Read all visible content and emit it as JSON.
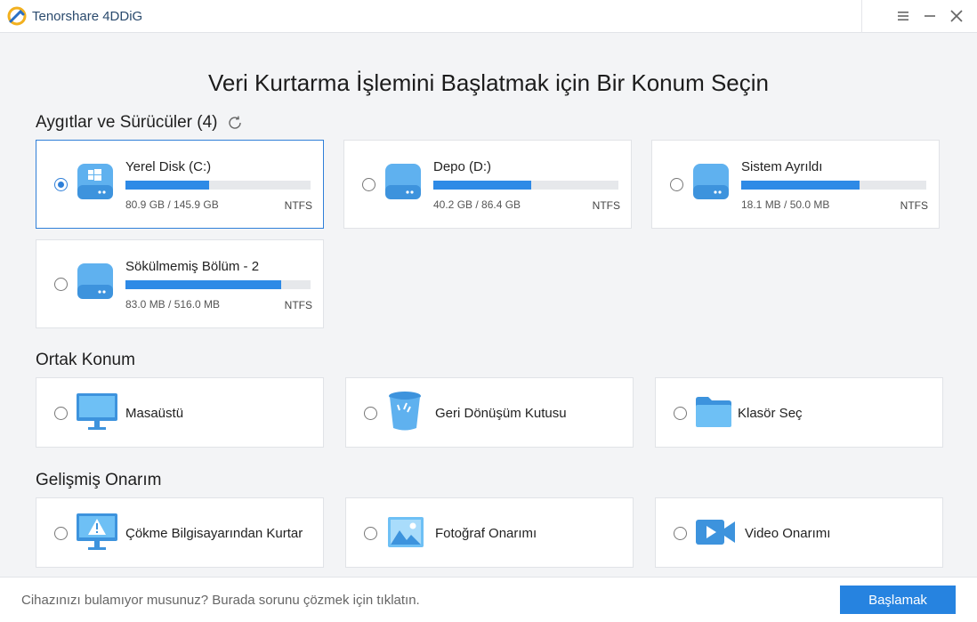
{
  "window": {
    "title": "Tenorshare 4DDiG"
  },
  "heading": "Veri Kurtarma İşlemini Başlatmak için Bir Konum Seçin",
  "devices": {
    "title": "Aygıtlar ve Sürücüler (4)",
    "items": [
      {
        "name": "Yerel Disk (C:)",
        "size": "80.9 GB / 145.9 GB",
        "fs": "NTFS",
        "used_fraction": 0.45,
        "selected": true
      },
      {
        "name": "Depo (D:)",
        "size": "40.2 GB / 86.4 GB",
        "fs": "NTFS",
        "used_fraction": 0.53,
        "selected": false
      },
      {
        "name": "Sistem Ayrıldı",
        "size": "18.1 MB / 50.0 MB",
        "fs": "NTFS",
        "used_fraction": 0.64,
        "selected": false
      },
      {
        "name": "Sökülmemiş Bölüm - 2",
        "size": "83.0 MB / 516.0 MB",
        "fs": "NTFS",
        "used_fraction": 0.84,
        "selected": false
      }
    ]
  },
  "common": {
    "title": "Ortak Konum",
    "items": [
      {
        "label": "Masaüstü",
        "icon": "monitor-icon"
      },
      {
        "label": "Geri Dönüşüm Kutusu",
        "icon": "recycle-bin-icon"
      },
      {
        "label": "Klasör Seç",
        "icon": "folder-icon"
      }
    ]
  },
  "advanced": {
    "title": "Gelişmiş Onarım",
    "items": [
      {
        "label": "Çökme Bilgisayarından Kurtar",
        "icon": "crashed-pc-icon"
      },
      {
        "label": "Fotoğraf Onarımı",
        "icon": "photo-icon"
      },
      {
        "label": "Video Onarımı",
        "icon": "video-icon"
      }
    ]
  },
  "footer": {
    "help_text": "Cihazınızı bulamıyor musunuz? Burada sorunu çözmek için tıklatın.",
    "start_label": "Başlamak"
  },
  "colors": {
    "accent": "#2683e0",
    "bar": "#2e8ae6",
    "track": "#e6e8eb"
  }
}
